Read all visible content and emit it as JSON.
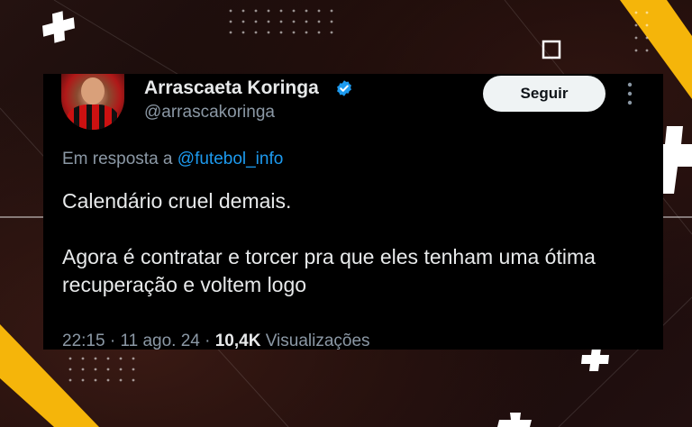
{
  "tweet": {
    "author_name": "Arrascaeta Koringa",
    "handle": "@arrascakoringa",
    "follow_label": "Seguir",
    "reply_prefix": "Em resposta a",
    "reply_mention": "@futebol_info",
    "paragraphs": [
      "Calendário cruel demais.",
      "Agora é contratar e torcer pra que eles tenham uma ótima recuperação e voltem logo"
    ],
    "time": "22:15",
    "separator": "·",
    "date": "11 ago. 24",
    "views_count": "10,4K",
    "views_label": "Visualizações"
  },
  "icons": {
    "verified": "verified-badge-icon",
    "more": "more-vertical-icon"
  },
  "colors": {
    "accent": "#1d9bf0",
    "decoration_yellow": "#f5b50a",
    "card": "#000000",
    "text": "#e7e9ea",
    "muted": "#8b98a5"
  }
}
